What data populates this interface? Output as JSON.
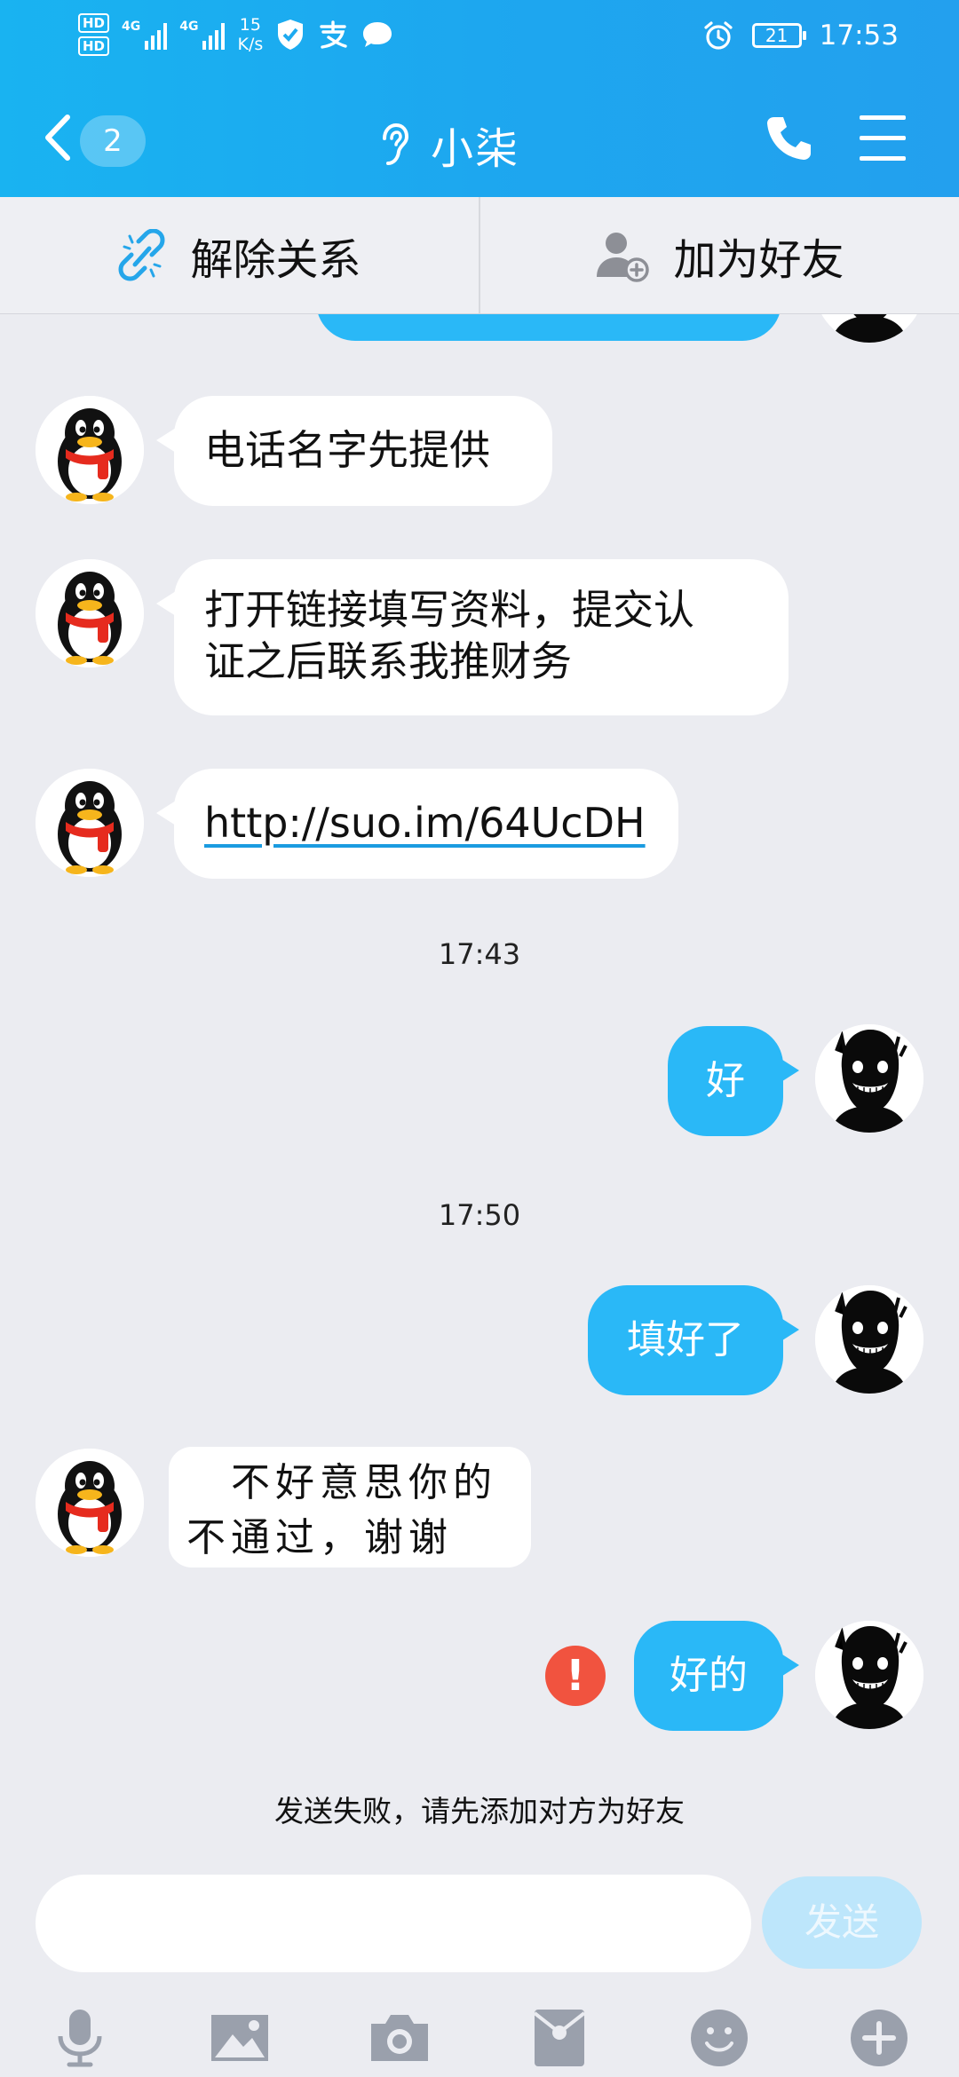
{
  "status_bar": {
    "hd1": "HD",
    "hd2": "HD",
    "signal1": "4G",
    "signal2": "4G",
    "speed_value": "15",
    "speed_unit": "K/s",
    "battery": "21",
    "time": "17:53"
  },
  "header": {
    "unread_count": "2",
    "title": "小柒"
  },
  "actions": {
    "remove_relation": "解除关系",
    "add_friend": "加为好友"
  },
  "messages": {
    "m1": "电话名字先提供",
    "m2_line1": "打开链接填写资料，提交认",
    "m2_line2": "证之后联系我推财务",
    "m3_link": "http://suo.im/64UcDH",
    "ts1": "17:43",
    "m4": "好",
    "ts2": "17:50",
    "m5": "填好了",
    "m6_line1": "不好意思你的",
    "m6_line2": "不通过，谢谢",
    "m7": "好的",
    "fail_notice": "发送失败，请先添加对方为好友"
  },
  "input": {
    "value": "",
    "send_label": "发送"
  },
  "colors": {
    "header_blue": "#1da7ef",
    "bubble_blue": "#2ab8f7",
    "fail_red": "#f1533f"
  }
}
